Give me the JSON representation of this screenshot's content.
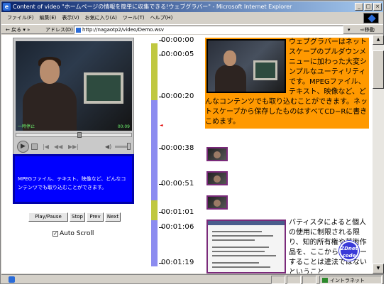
{
  "window": {
    "title": "Content of video \"ホームページの情報を簡単に収集できる!ウェブグラバー\" - Microsoft Internet Explorer"
  },
  "menu": [
    "ファイル(F)",
    "編集(E)",
    "表示(V)",
    "お気に入り(A)",
    "ツール(T)",
    "ヘルプ(H)"
  ],
  "toolbar": {
    "back_label": "← 戻る ▾ »",
    "address_label": "アドレス(D)",
    "address_value": "http://nagaotp2/video/Demo.wsv",
    "go_label": "移動"
  },
  "player": {
    "overlay_left": "一時停止",
    "overlay_right": "00:09",
    "seek_progress": 0.55,
    "caption": "MPEGファイル、テキスト、映像など、どんなコンテンツでも取り込むことができます。",
    "buttons": {
      "play_pause": "Play/Pause",
      "stop": "Stop",
      "prev": "Prev",
      "next": "Next"
    },
    "auto_scroll_label": "Auto Scroll",
    "auto_scroll_checked": true
  },
  "timeline": {
    "labels": [
      "00:00:00",
      "00:00:05",
      "00:00:20",
      "00:00:38",
      "00:00:51",
      "00:01:01",
      "00:01:06",
      "00:01:19"
    ],
    "current_marker": "◄"
  },
  "story1": {
    "text": "ウェブグラバーはネットスケープのプルダウンメニューに加わった大変シンプルなユーティリティです。MPEGファイル、テキスト、映像など、どんなコンテンツでも取り込むことができます。ネットスケープから保存したものはすべてCD−Rに書きこめます。"
  },
  "story2": {
    "text": "バティスタによると個人の使用に制限される限り、知的所有権や芸術作品を、ここからにコピーすることは違法ではないということ"
  },
  "logo_text": "ZDnet code",
  "status": {
    "zone": "イントラネット"
  },
  "colors": {
    "story1_bg": "#ff9900",
    "caption_bg": "#0000ff",
    "timeline_green": "#c0c840",
    "timeline_blue": "#8c8cf0"
  }
}
